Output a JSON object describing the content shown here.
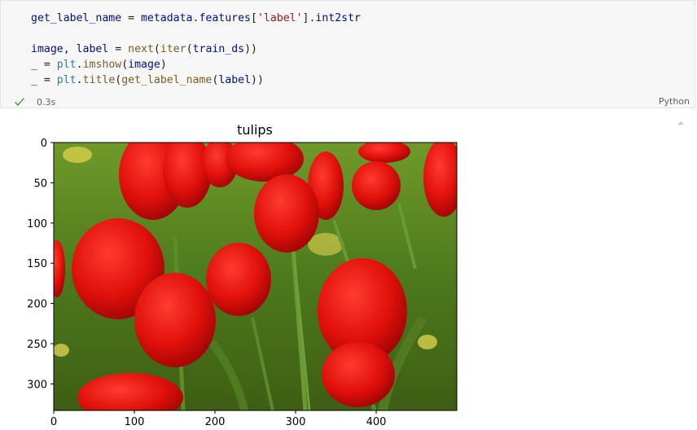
{
  "cell": {
    "code_lines": [
      [
        {
          "t": "get_label_name",
          "c": "tok-var"
        },
        {
          "t": " = ",
          "c": "tok-op"
        },
        {
          "t": "metadata",
          "c": "tok-var"
        },
        {
          "t": ".",
          "c": "tok-op"
        },
        {
          "t": "features",
          "c": "tok-var"
        },
        {
          "t": "[",
          "c": "tok-op"
        },
        {
          "t": "'label'",
          "c": "tok-str"
        },
        {
          "t": "].",
          "c": "tok-op"
        },
        {
          "t": "int2str",
          "c": "tok-var"
        }
      ],
      [],
      [
        {
          "t": "image",
          "c": "tok-var"
        },
        {
          "t": ", ",
          "c": "tok-op"
        },
        {
          "t": "label",
          "c": "tok-var"
        },
        {
          "t": " = ",
          "c": "tok-op"
        },
        {
          "t": "next",
          "c": "tok-fn"
        },
        {
          "t": "(",
          "c": "tok-op"
        },
        {
          "t": "iter",
          "c": "tok-fn"
        },
        {
          "t": "(",
          "c": "tok-op"
        },
        {
          "t": "train_ds",
          "c": "tok-var"
        },
        {
          "t": "))",
          "c": "tok-op"
        }
      ],
      [
        {
          "t": "_",
          "c": "tok-var"
        },
        {
          "t": " = ",
          "c": "tok-op"
        },
        {
          "t": "plt",
          "c": "tok-mod"
        },
        {
          "t": ".",
          "c": "tok-op"
        },
        {
          "t": "imshow",
          "c": "tok-fn"
        },
        {
          "t": "(",
          "c": "tok-op"
        },
        {
          "t": "image",
          "c": "tok-var"
        },
        {
          "t": ")",
          "c": "tok-op"
        }
      ],
      [
        {
          "t": "_",
          "c": "tok-var"
        },
        {
          "t": " = ",
          "c": "tok-op"
        },
        {
          "t": "plt",
          "c": "tok-mod"
        },
        {
          "t": ".",
          "c": "tok-op"
        },
        {
          "t": "title",
          "c": "tok-fn"
        },
        {
          "t": "(",
          "c": "tok-op"
        },
        {
          "t": "get_label_name",
          "c": "tok-fn"
        },
        {
          "t": "(",
          "c": "tok-op"
        },
        {
          "t": "label",
          "c": "tok-var"
        },
        {
          "t": "))",
          "c": "tok-op"
        }
      ]
    ],
    "exec_time": "0.3s",
    "language": "Python",
    "status_icon": "check-icon",
    "colors": {
      "check": "#388a34",
      "cell_bg": "#f7f7f7"
    }
  },
  "output": {
    "plot_title": "tulips",
    "x_ticks": [
      "0",
      "100",
      "200",
      "300",
      "400"
    ],
    "y_ticks": [
      "0",
      "50",
      "100",
      "150",
      "200",
      "250",
      "300"
    ],
    "image_description": "red tulips photo"
  }
}
